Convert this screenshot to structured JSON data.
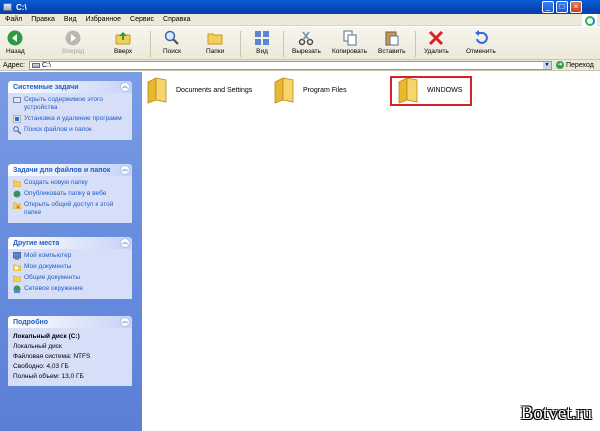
{
  "window": {
    "title": "C:\\"
  },
  "menu": [
    "Файл",
    "Правка",
    "Вид",
    "Избранное",
    "Сервис",
    "Справка"
  ],
  "toolbar": {
    "back": "Назад",
    "forward": "Вперед",
    "up": "Вверх",
    "search": "Поиск",
    "folders": "Папки",
    "view": "Вид",
    "cut": "Вырезать",
    "copy": "Копировать",
    "paste": "Вставить",
    "delete": "Удалить",
    "undo": "Отменить"
  },
  "address": {
    "label": "Адрес:",
    "value": "C:\\",
    "go": "Переход"
  },
  "panels": {
    "system": {
      "title": "Системные задачи",
      "items": [
        "Скрыть содержимое этого устройства",
        "Установка и удаление программ",
        "Поиск файлов и папок"
      ]
    },
    "file_tasks": {
      "title": "Задачи для файлов и папок",
      "items": [
        "Создать новую папку",
        "Опубликовать папку в вебе",
        "Открыть общий доступ к этой папке"
      ]
    },
    "other_places": {
      "title": "Другие места",
      "items": [
        "Мой компьютер",
        "Мои документы",
        "Общие документы",
        "Сетевое окружение"
      ]
    },
    "details": {
      "title": "Подробно",
      "name": "Локальный диск (C:)",
      "type": "Локальный диск",
      "fs": "Файловая система: NTFS",
      "free": "Свободно: 4,03 ГБ",
      "total": "Полный объем: 13,0 ГБ"
    }
  },
  "folders": [
    "Documents and Settings",
    "Program Files",
    "WINDOWS"
  ],
  "watermark": "Botvet.ru",
  "colors": {
    "titlebar": "#0846b8",
    "link": "#215dc6",
    "highlight": "#d8202a"
  }
}
